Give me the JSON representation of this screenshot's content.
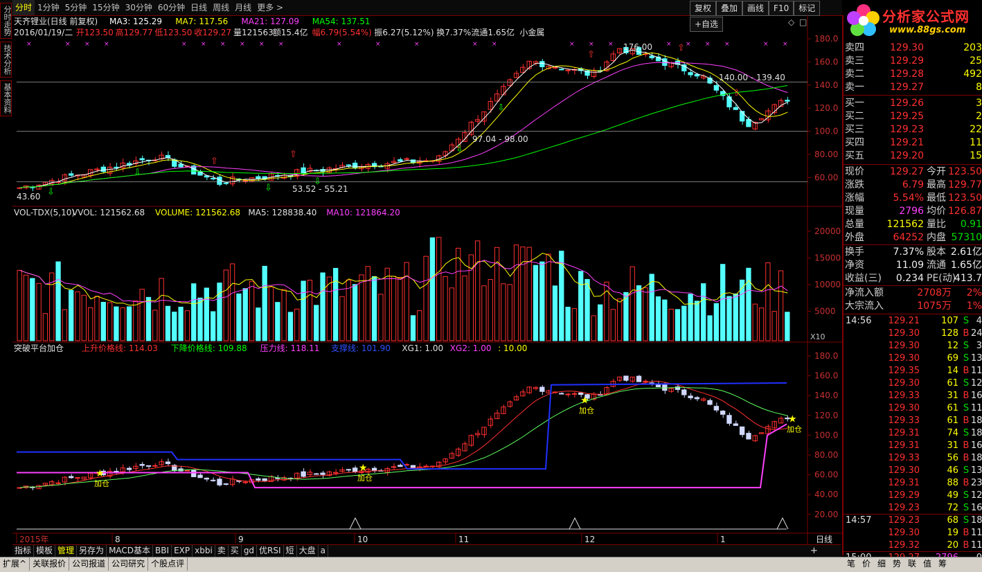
{
  "timeframes": [
    "分时",
    "1分钟",
    "5分钟",
    "15分钟",
    "30分钟",
    "60分钟",
    "日线",
    "周线",
    "月线",
    "更多 >"
  ],
  "active_timeframe": "分时",
  "toolbar_right": [
    "复权",
    "叠加",
    "画线",
    "F10",
    "标记",
    "+自选"
  ],
  "logo": {
    "title": "分析家公式网",
    "url": "www.88gs.com"
  },
  "side_tabs": [
    "分时走势",
    "技术分析",
    "基本资料"
  ],
  "main_chart": {
    "stock_title": "天齐锂业(日线 前复权)",
    "ma_labels": [
      {
        "text": "MA3: 125.29",
        "color": "#ffffff"
      },
      {
        "text": "MA7: 117.56",
        "color": "#ffff00"
      },
      {
        "text": "MA21: 127.09",
        "color": "#ff40ff"
      },
      {
        "text": "MA54: 137.51",
        "color": "#00ff00"
      }
    ],
    "info_line": {
      "date": "2016/01/19/二",
      "open": "开123.50",
      "high": "高129.77",
      "low": "低123.50",
      "close": "收129.27",
      "volume": "量121563",
      "amount": "额15.4亿",
      "range": "幅6.79(5.54%)",
      "amplitude": "振6.27(5.12%)",
      "turnover": "换7.37%",
      "float": "流通1.65亿",
      "category": "小金属"
    },
    "annotations": [
      "176.00",
      "140.00 - 139.40",
      "97.04 - 98.00",
      "53.52 - 55.21",
      "43.60"
    ],
    "y_ticks": [
      "180.0",
      "160.0",
      "140.0",
      "120.0",
      "100.0",
      "80.00",
      "60.00"
    ]
  },
  "volume_chart": {
    "title": "VOL-TDX(5,10)",
    "labels": [
      {
        "text": "VVOL: 121562.68",
        "color": "#e0e0e0"
      },
      {
        "text": "VOLUME: 121562.68",
        "color": "#ffff00"
      },
      {
        "text": "MA5: 128838.40",
        "color": "#e0e0e0"
      },
      {
        "text": "MA10: 121864.20",
        "color": "#ff40ff"
      }
    ],
    "y_ticks": [
      "20000",
      "15000",
      "10000",
      "5000"
    ],
    "scale": "X10"
  },
  "indicator_chart": {
    "title": "突破平台加仓",
    "labels": [
      {
        "text": "上升价格线: 114.03",
        "color": "#ff3030"
      },
      {
        "text": "下降价格线: 109.88",
        "color": "#00ff00"
      },
      {
        "text": "压力线: 118.11",
        "color": "#ff40ff"
      },
      {
        "text": "支撑线: 101.90",
        "color": "#3050ff"
      },
      {
        "text": "XG1: 1.00",
        "color": "#e0e0e0"
      },
      {
        "text": "XG2: 1.00",
        "color": "#ff40ff"
      },
      {
        "text": ": 10.00",
        "color": "#ffff00"
      }
    ],
    "y_ticks": [
      "180.0",
      "160.0",
      "140.0",
      "120.0",
      "100.0",
      "80.00",
      "60.00",
      "40.00",
      "20.00"
    ],
    "signal_label": "加仓"
  },
  "x_axis": {
    "labels": [
      "2015年",
      "8",
      "9",
      "10",
      "11",
      "12",
      "1"
    ],
    "period": "日线"
  },
  "bottom_tabs": [
    "指标",
    "模板",
    "管理",
    "另存为",
    "MACD基本",
    "BBI",
    "EXP",
    "xbbi",
    "卖",
    "买",
    "gd",
    "优RSI",
    "短",
    "大盘",
    "a"
  ],
  "status_tabs": [
    "扩展^",
    "关联报价",
    "公司报道",
    "公司研究",
    "个股点评"
  ],
  "right_tabs": [
    "笔",
    "价",
    "细",
    "势",
    "联",
    "值",
    "筹"
  ],
  "order_book": {
    "asks": [
      {
        "label": "卖四",
        "price": "129.30",
        "vol": "203"
      },
      {
        "label": "卖三",
        "price": "129.29",
        "vol": "25"
      },
      {
        "label": "卖二",
        "price": "129.28",
        "vol": "492"
      },
      {
        "label": "卖一",
        "price": "129.27",
        "vol": "8"
      }
    ],
    "bids": [
      {
        "label": "买一",
        "price": "129.26",
        "vol": "3"
      },
      {
        "label": "买二",
        "price": "129.25",
        "vol": "2"
      },
      {
        "label": "买三",
        "price": "129.23",
        "vol": "22"
      },
      {
        "label": "买四",
        "price": "129.21",
        "vol": "11"
      },
      {
        "label": "买五",
        "price": "129.20",
        "vol": "15"
      }
    ]
  },
  "quote_stats": [
    {
      "l1": "现价",
      "v1": "129.27",
      "c1": "red",
      "l2": "今开",
      "v2": "123.50",
      "c2": "red"
    },
    {
      "l1": "涨跌",
      "v1": "6.79",
      "c1": "red",
      "l2": "最高",
      "v2": "129.77",
      "c2": "red"
    },
    {
      "l1": "涨幅",
      "v1": "5.54%",
      "c1": "red",
      "l2": "最低",
      "v2": "123.50",
      "c2": "red"
    },
    {
      "l1": "现量",
      "v1": "2796",
      "c1": "mag",
      "l2": "均价",
      "v2": "126.87",
      "c2": "red"
    },
    {
      "l1": "总量",
      "v1": "121562",
      "c1": "yel",
      "l2": "量比",
      "v2": "0.91",
      "c2": "grn"
    },
    {
      "l1": "外盘",
      "v1": "64252",
      "c1": "red",
      "l2": "内盘",
      "v2": "57310",
      "c2": "grn"
    },
    {
      "l1": "换手",
      "v1": "7.37%",
      "c1": "wht",
      "l2": "股本",
      "v2": "2.61亿",
      "c2": "wht"
    },
    {
      "l1": "净资",
      "v1": "11.09",
      "c1": "wht",
      "l2": "流通",
      "v2": "1.65亿",
      "c2": "wht"
    },
    {
      "l1": "收益(三)",
      "v1": "0.234",
      "c1": "wht",
      "l2": "PE(动)",
      "v2": "413.7",
      "c2": "wht"
    }
  ],
  "net_flow": [
    {
      "label": "净流入额",
      "value": "2708万",
      "pct": "2%"
    },
    {
      "label": "大宗流入",
      "value": "1075万",
      "pct": "1%"
    }
  ],
  "ticks": [
    {
      "time": "14:56",
      "price": "129.21",
      "vol": "107",
      "bs": "S",
      "cnt": "4"
    },
    {
      "time": "",
      "price": "129.30",
      "vol": "128",
      "bs": "B",
      "cnt": "24"
    },
    {
      "time": "",
      "price": "129.30",
      "vol": "12",
      "bs": "S",
      "cnt": "3"
    },
    {
      "time": "",
      "price": "129.30",
      "vol": "69",
      "bs": "S",
      "cnt": "13"
    },
    {
      "time": "",
      "price": "129.35",
      "vol": "14",
      "bs": "B",
      "cnt": "11"
    },
    {
      "time": "",
      "price": "129.30",
      "vol": "61",
      "bs": "S",
      "cnt": "12"
    },
    {
      "time": "",
      "price": "129.33",
      "vol": "31",
      "bs": "B",
      "cnt": "16"
    },
    {
      "time": "",
      "price": "129.30",
      "vol": "61",
      "bs": "S",
      "cnt": "11"
    },
    {
      "time": "",
      "price": "129.33",
      "vol": "61",
      "bs": "B",
      "cnt": "18"
    },
    {
      "time": "",
      "price": "129.31",
      "vol": "74",
      "bs": "S",
      "cnt": "18"
    },
    {
      "time": "",
      "price": "129.31",
      "vol": "31",
      "bs": "B",
      "cnt": "16"
    },
    {
      "time": "",
      "price": "129.33",
      "vol": "56",
      "bs": "B",
      "cnt": "18"
    },
    {
      "time": "",
      "price": "129.30",
      "vol": "46",
      "bs": "S",
      "cnt": "13"
    },
    {
      "time": "",
      "price": "129.31",
      "vol": "88",
      "bs": "B",
      "cnt": "23"
    },
    {
      "time": "",
      "price": "129.29",
      "vol": "49",
      "bs": "S",
      "cnt": "12"
    },
    {
      "time": "",
      "price": "129.23",
      "vol": "72",
      "bs": "S",
      "cnt": "16"
    },
    {
      "time": "14:57",
      "price": "129.23",
      "vol": "68",
      "bs": "S",
      "cnt": "18"
    },
    {
      "time": "",
      "price": "129.30",
      "vol": "19",
      "bs": "B",
      "cnt": "11"
    },
    {
      "time": "",
      "price": "129.32",
      "vol": "20",
      "bs": "B",
      "cnt": "11"
    },
    {
      "time": "15:00",
      "price": "129.27",
      "vol": "2796",
      "bs": "",
      "cnt": "0"
    }
  ],
  "colors": {
    "up": "#ff3030",
    "down": "#54ffff",
    "frame": "#800000",
    "ma3": "#ffffff",
    "ma7": "#ffff00",
    "ma21": "#ff40ff",
    "ma54": "#00ff00",
    "support": "#2030ff",
    "pressure": "#ff40ff"
  }
}
